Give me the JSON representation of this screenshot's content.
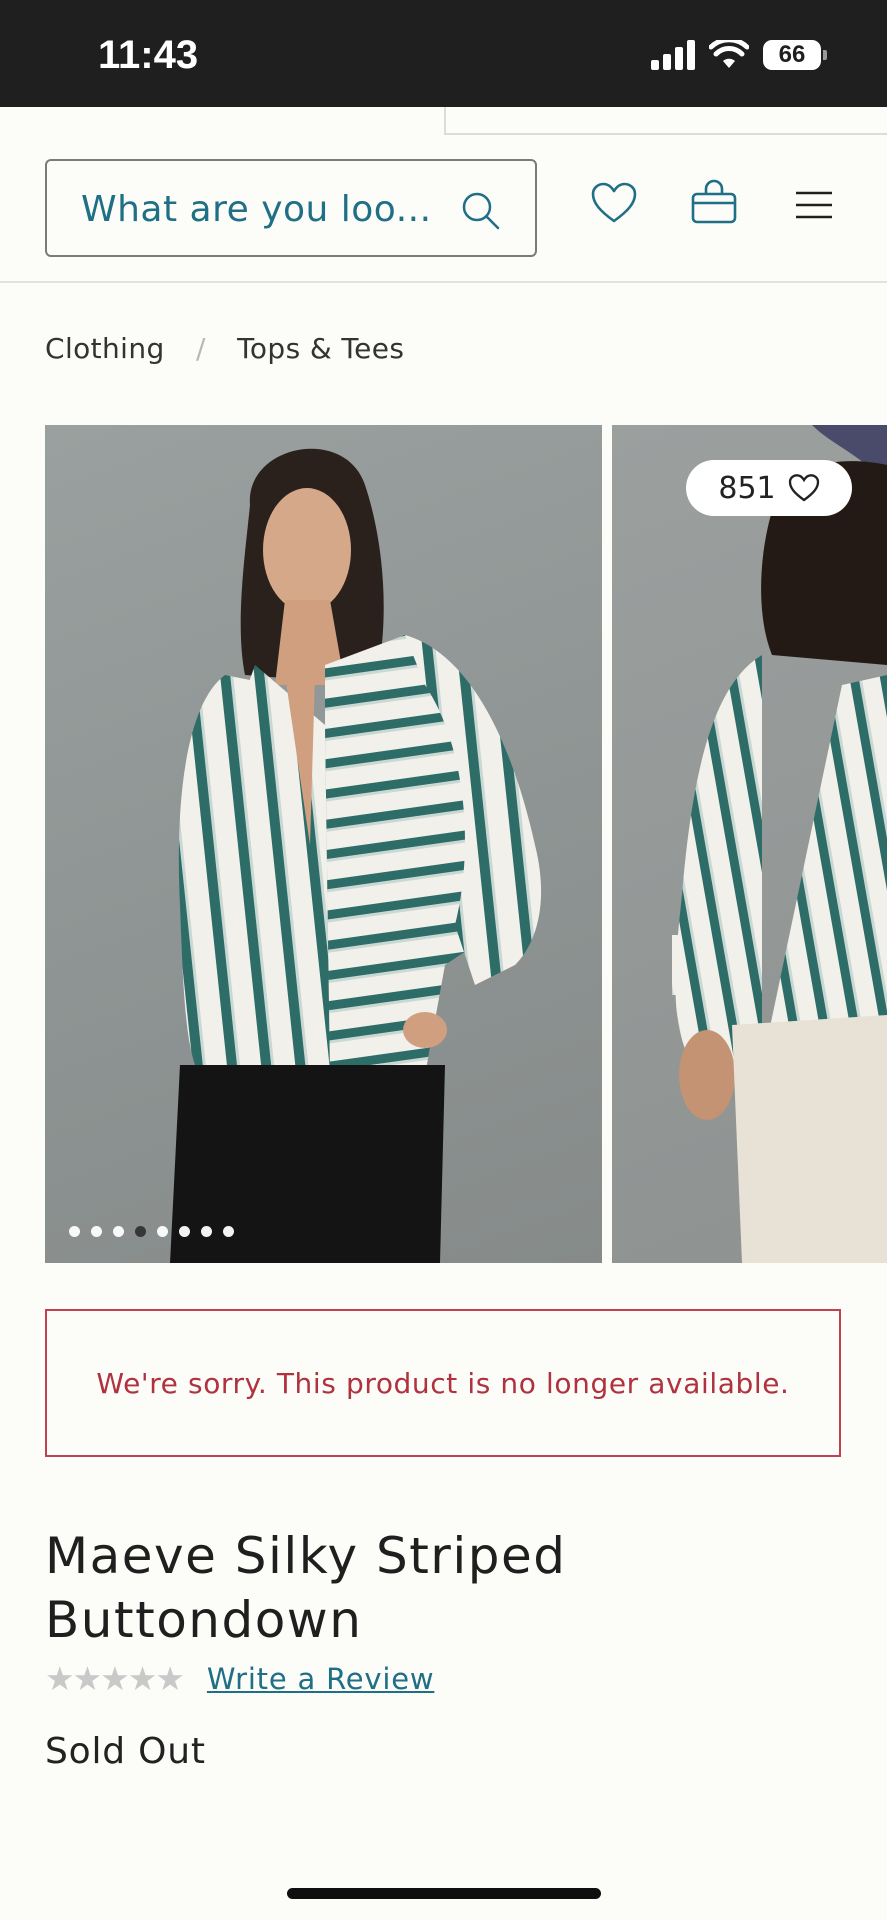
{
  "status_bar": {
    "time": "11:43",
    "battery": "66"
  },
  "header": {
    "search_placeholder": "What are you loo...",
    "icons": [
      "search-icon",
      "heart-icon",
      "shopping-bag-icon",
      "menu-icon"
    ]
  },
  "breadcrumb": {
    "items": [
      "Clothing",
      "Tops & Tees"
    ],
    "separator": "/"
  },
  "gallery": {
    "likes_count": "851",
    "image_count": 8,
    "active_index": 3
  },
  "alert": {
    "message": "We're sorry. This product is no longer available.",
    "color": "#b0323f"
  },
  "product": {
    "title": "Maeve Silky Striped Buttondown",
    "rating": 0,
    "rating_max": 5,
    "review_link": "Write a Review",
    "availability": "Sold Out"
  },
  "colors": {
    "accent": "#1f6f86",
    "alert_border": "#c0414f",
    "status_bar": "#1f1f1f"
  }
}
